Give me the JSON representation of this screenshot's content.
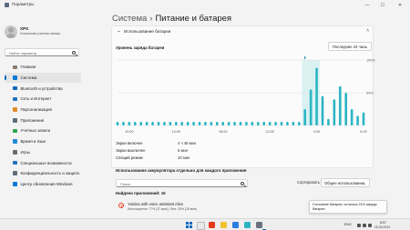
{
  "window": {
    "title": "Параметры",
    "controls": {
      "minimize": "—",
      "maximize": "☐",
      "close": "✕"
    }
  },
  "profile": {
    "name": "XPS",
    "subtitle": "Локальная учетная запись"
  },
  "search": {
    "placeholder": "Найти параметр"
  },
  "sidebar": {
    "items": [
      {
        "label": "Главная",
        "icon": "home-icon",
        "color": "#8a7a6a"
      },
      {
        "label": "Система",
        "icon": "system-icon",
        "color": "#0078d4",
        "active": true
      },
      {
        "label": "Bluetooth и устройства",
        "icon": "bluetooth-icon",
        "color": "#0067c0"
      },
      {
        "label": "Сеть и Интернет",
        "icon": "wifi-icon",
        "color": "#1e73be"
      },
      {
        "label": "Персонализация",
        "icon": "brush-icon",
        "color": "#e08a2c"
      },
      {
        "label": "Приложения",
        "icon": "apps-icon",
        "color": "#5a6a7a"
      },
      {
        "label": "Учетные записи",
        "icon": "account-icon",
        "color": "#2da44e"
      },
      {
        "label": "Время и язык",
        "icon": "globe-icon",
        "color": "#1f8ad3"
      },
      {
        "label": "Игры",
        "icon": "gamepad-icon",
        "color": "#6b6b6b"
      },
      {
        "label": "Специальные возможности",
        "icon": "accessibility-icon",
        "color": "#1e73be"
      },
      {
        "label": "Конфиденциальность и защита",
        "icon": "shield-icon",
        "color": "#5f6b78"
      },
      {
        "label": "Центр обновления Windows",
        "icon": "update-icon",
        "color": "#0078d4"
      }
    ]
  },
  "main": {
    "breadcrumb": {
      "parent": "Система",
      "separator": "›",
      "current": "Питание и батарея"
    },
    "usage_header": "Использование батареи",
    "battery_level_title": "Уровень заряда батареи",
    "period": {
      "selected": "Последние 24 часа"
    }
  },
  "summary": [
    {
      "label": "Экран включен",
      "value": "4 ч 49 мин"
    },
    {
      "label": "Экран выключен",
      "value": "5 мин"
    },
    {
      "label": "Спящий режим",
      "value": "10 мин"
    }
  ],
  "apps": {
    "title": "Использование аккумулятора отдельно для каждого приложения",
    "search_placeholder": "Поиск",
    "sort_label": "Сортировать",
    "sort_selected": "Общее использование",
    "found": "Найдено приложений: 15",
    "entry": {
      "name": "Yandex with voice assistant Alice",
      "usage": "Используется: 77% (37 мин) | Фон: 25% (28 мин)"
    }
  },
  "tooltip": "Состояние батареи: осталось 21% заряда батареи",
  "taskbar": {
    "lang": "ENG",
    "time": "8:57",
    "date": "20.04.2024"
  },
  "colors": {
    "accent": "#0067c0",
    "bar": "#2bb5c4",
    "bar_dark": "#1f8f9d",
    "highlight": "#d9f1f1"
  },
  "chart_data": {
    "type": "bar",
    "title": "Уровень заряда батареи",
    "ylabel": "",
    "yticks": [
      "100%",
      "50%"
    ],
    "ylim": [
      0,
      100
    ],
    "xticks": [
      "10:00",
      "14:00",
      "18:00",
      "22:00",
      "2:00",
      "6:00"
    ],
    "series": [
      {
        "values": [
          0,
          0,
          0,
          0,
          0,
          0,
          0,
          0,
          0,
          0,
          0,
          0,
          0,
          0,
          0,
          0,
          0,
          0,
          0,
          0,
          0,
          0,
          0,
          0,
          0,
          0,
          0,
          0,
          0,
          0,
          0,
          0,
          25,
          55,
          88,
          45,
          10,
          40,
          60,
          50,
          25,
          15,
          20
        ]
      }
    ],
    "highlight_range": [
      32,
      34
    ],
    "grid": true
  }
}
